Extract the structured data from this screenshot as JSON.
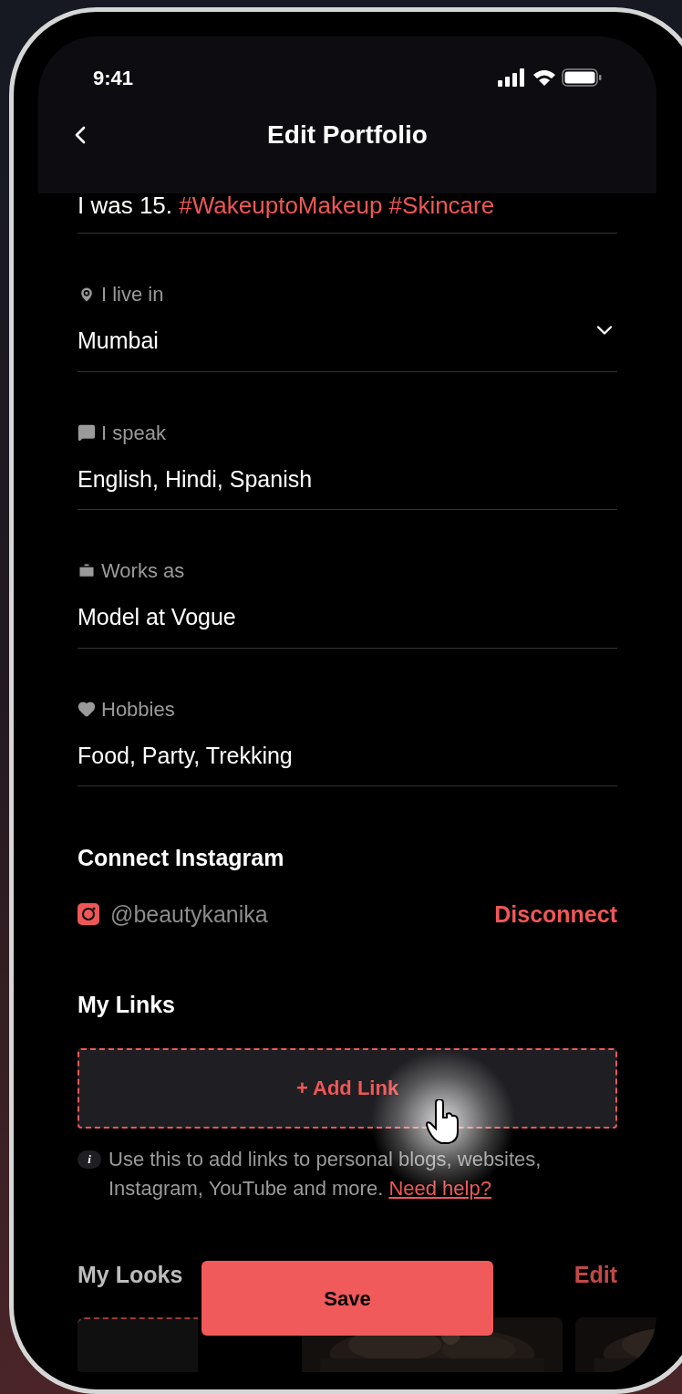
{
  "status_bar": {
    "time": "9:41"
  },
  "header": {
    "title": "Edit Portfolio"
  },
  "bio": {
    "plain": "I was 15.",
    "tags": "#WakeuptoMakeup #Skincare"
  },
  "fields": [
    {
      "kind": "location",
      "label": "I live in",
      "value": "Mumbai",
      "dropdown": true
    },
    {
      "kind": "chat",
      "label": "I speak",
      "value": "English, Hindi, Spanish",
      "dropdown": false
    },
    {
      "kind": "work",
      "label": "Works as",
      "value": "Model at Vogue",
      "dropdown": false
    },
    {
      "kind": "heart",
      "label": "Hobbies",
      "value": "Food, Party, Trekking",
      "dropdown": false
    }
  ],
  "instagram": {
    "heading": "Connect Instagram",
    "handle": "@beautykanika",
    "action": "Disconnect"
  },
  "links": {
    "heading": "My Links",
    "add_button": "+ Add Link",
    "info_icon": "i",
    "hint": "Use this to add links to personal blogs, websites, Instagram, YouTube and more.",
    "help_link": "Need help?"
  },
  "looks": {
    "heading": "My Looks",
    "action": "Edit",
    "items": [
      {
        "kind": "placeholder"
      },
      {
        "kind": "picture"
      },
      {
        "kind": "picture"
      }
    ]
  },
  "save_button": "Save"
}
